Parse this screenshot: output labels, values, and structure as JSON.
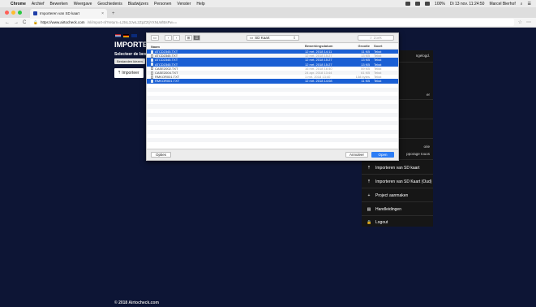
{
  "menubar": {
    "apple": "",
    "app": "Chrome",
    "items": [
      "Archief",
      "Bewerken",
      "Weergave",
      "Geschiedenis",
      "Bladwijzers",
      "Personen",
      "Venster",
      "Help"
    ],
    "battery": "100%",
    "datetime": "Di 13 nov. 11:24:50",
    "user": "Marcel Bierhof"
  },
  "browser": {
    "tab_title": "Importeren van SD kaart",
    "tab_close": "×",
    "new_tab": "+",
    "url_host": "https://www.airtocheck.com",
    "url_rest": "/nl/import-nl?return=L2tsL3JwL2ZpZ2tjYXNLWlBsPw==",
    "back": "←",
    "forward": "→",
    "reload": "C",
    "star": "☆",
    "more": "⋯"
  },
  "page": {
    "title": "IMPORTEER",
    "subtitle": "Selecteer de bestan",
    "file_button": "Bestanden kiezen",
    "import_button": "Importeer",
    "footer": "© 2018 Airtocheck.com"
  },
  "side_menu": {
    "fragments": [
      "ngelogd.",
      "er",
      "orie",
      "pporage Iouos"
    ],
    "items": [
      {
        "icon": "upload-icon",
        "glyph": "⤒",
        "label": "Importeren van SD kaart"
      },
      {
        "icon": "upload-icon",
        "glyph": "⤒",
        "label": "Importeren van SD Kaart (Oud)"
      },
      {
        "icon": "plus-icon",
        "glyph": "+",
        "label": "Project aanmaken"
      },
      {
        "icon": "book-icon",
        "glyph": "▤",
        "label": "Handleidingen"
      },
      {
        "icon": "lock-icon",
        "glyph": "🔒",
        "label": "Logout"
      }
    ]
  },
  "dialog": {
    "location": "SD Kaart",
    "search_placeholder": "Zoek",
    "columns": {
      "name": "Naam",
      "date": "Bewerkingsdatum",
      "size": "Grootte",
      "kind": "Soort"
    },
    "files": [
      {
        "name": "ATCD2345.TXT",
        "date": "12 mrt. 2018 14:11",
        "size": "11 KB",
        "kind": "Tekst",
        "selected": true
      },
      {
        "name": "ATCD2345.TXT",
        "date": "12 mrt. 2018 15:27",
        "size": "13 KB",
        "kind": "Tekst",
        "selected": false
      },
      {
        "name": "ATCD2345.TXT",
        "date": "12 mrt. 2018 15:27",
        "size": "13 KB",
        "kind": "Tekst",
        "selected": true
      },
      {
        "name": "ATCD2345.TXT",
        "date": "12 mrt. 2018 15:27",
        "size": "13 KB",
        "kind": "Tekst",
        "selected": true
      },
      {
        "name": "CASE2002.TXT",
        "date": "16 mrt. 2018 16:40",
        "size": "59 KB",
        "kind": "Tekst",
        "selected": false
      },
      {
        "name": "CASE2004.TXT",
        "date": "24 apr. 2018 13:44",
        "size": "61 KB",
        "kind": "Tekst",
        "selected": false
      },
      {
        "name": "RMKOR001.TXT",
        "date": "1 mrt. 2018 13:40",
        "size": "138 bytes",
        "kind": "Tekst",
        "selected": false
      },
      {
        "name": "RMKOR001.TXT",
        "date": "12 mrt. 2018 14:08",
        "size": "11 KB",
        "kind": "Tekst",
        "selected": true
      }
    ],
    "options_button": "Opties",
    "cancel_button": "Annuleer",
    "open_button": "Open"
  },
  "colors": {
    "page_bg": "#0d1535",
    "selection": "#1a5fd4",
    "open_button": "#2d7df5",
    "menu_bg": "#161616"
  }
}
